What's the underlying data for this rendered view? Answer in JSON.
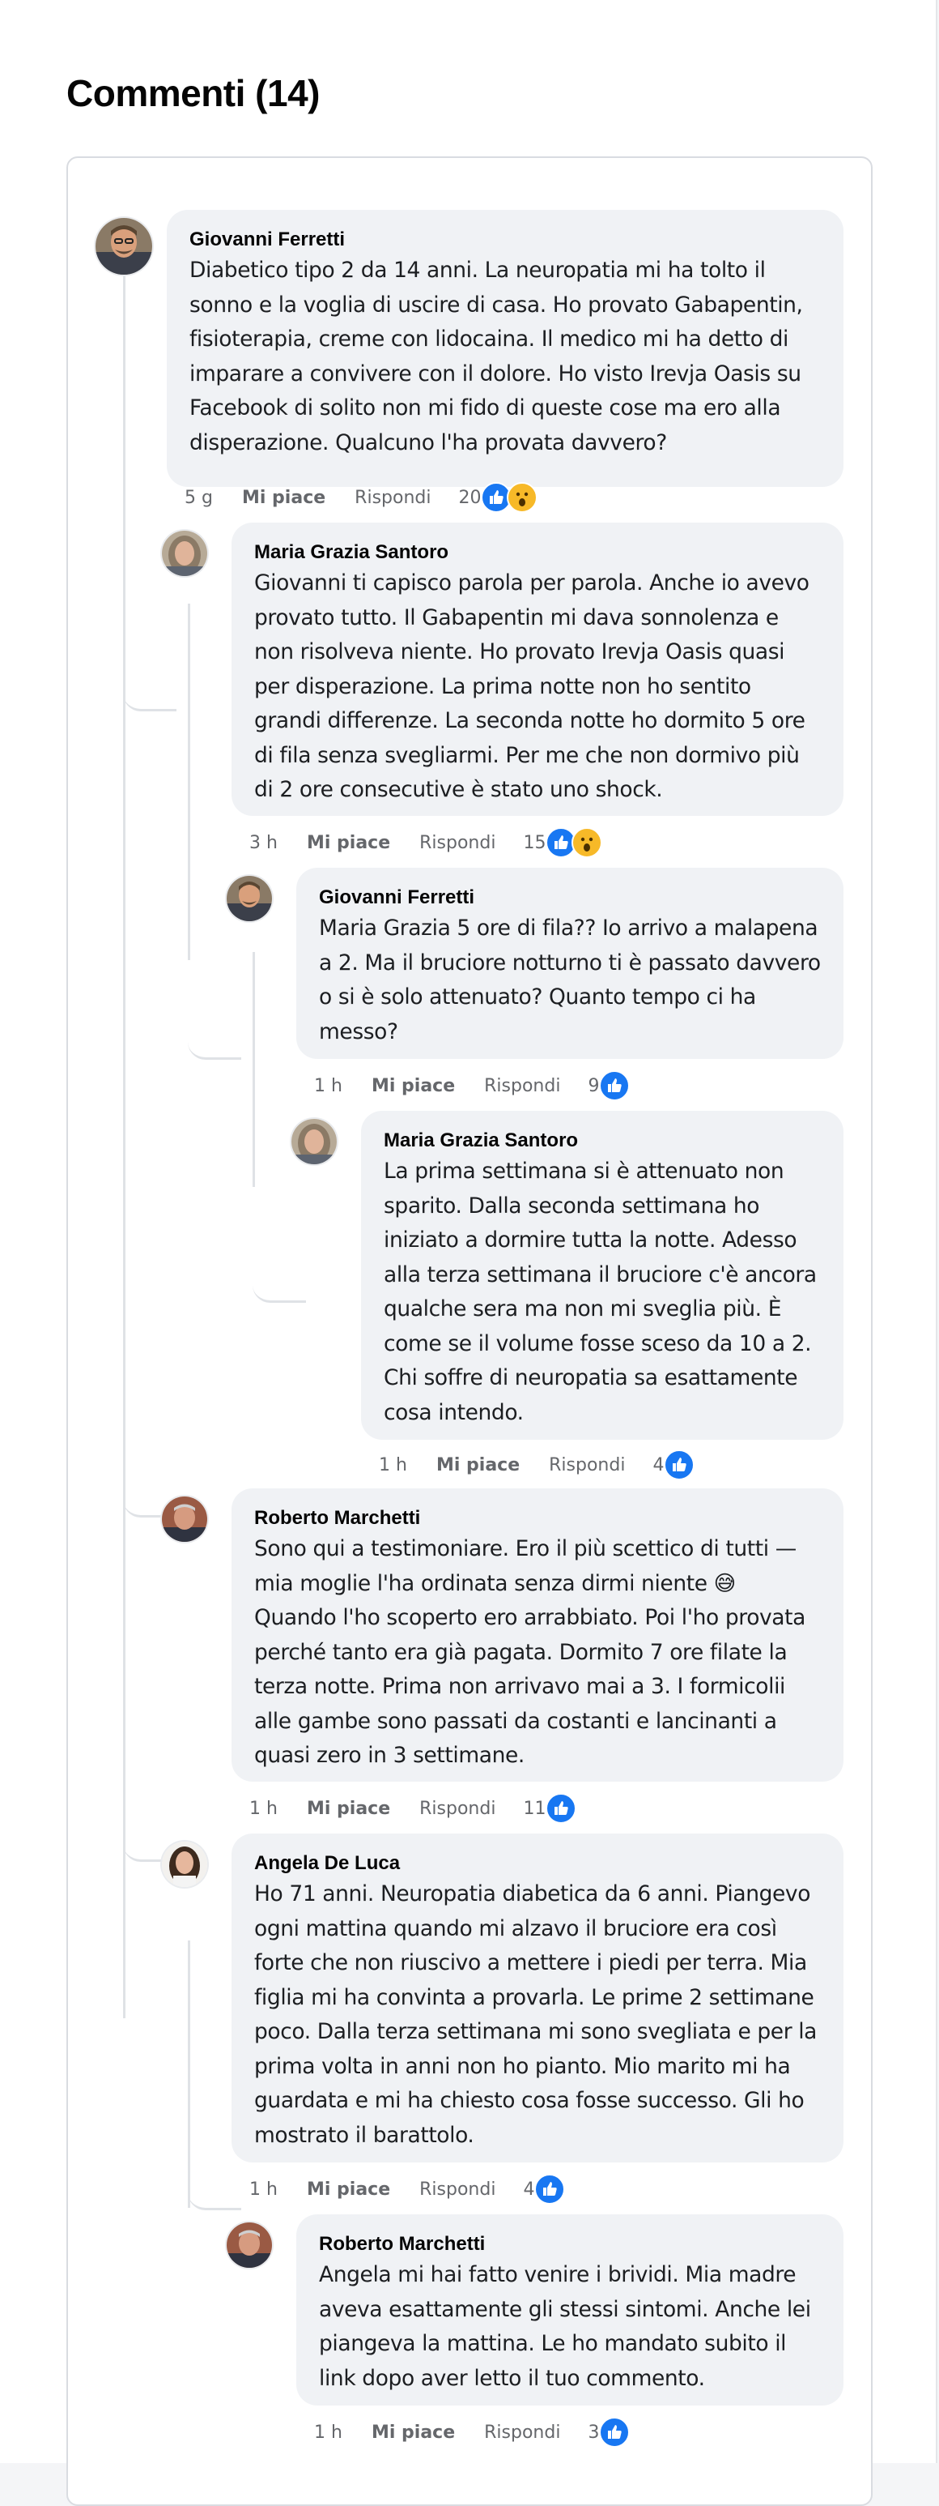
{
  "section": {
    "title": "Commenti (14)"
  },
  "colors": {
    "accent": "#1877f2",
    "bubble": "#f0f2f5",
    "meta": "#65676b",
    "wow": "#f7b928"
  },
  "actions": {
    "like": "Mi piace",
    "reply": "Rispondi"
  },
  "comments": [
    {
      "author": "Giovanni Ferretti",
      "text": "Diabetico tipo 2 da 14 anni. La neuropatia mi ha tolto il sonno e la voglia di uscire di casa. Ho provato Gabapentin, fisioterapia, creme con lidocaina. Il medico mi ha detto di imparare a convivere con il dolore. Ho visto Irevja Oasis su Facebook di solito non mi fido di queste cose ma ero alla disperazione. Qualcuno l'ha provata davvero?",
      "time": "5 g",
      "likes": "20",
      "reactions": [
        "thumbs-up-icon",
        "wow-icon"
      ]
    },
    {
      "author": "Maria Grazia Santoro",
      "text": "Giovanni ti capisco parola per parola. Anche io avevo provato tutto. Il Gabapentin mi dava sonnolenza e non risolveva niente. Ho provato Irevja Oasis quasi per disperazione. La prima notte non ho sentito grandi differenze. La seconda notte ho dormito 5 ore di fila senza svegliarmi. Per me che non dormivo più di 2 ore consecutive è stato uno shock.",
      "time": "3 h",
      "likes": "15",
      "reactions": [
        "thumbs-up-icon",
        "wow-icon"
      ]
    },
    {
      "author": "Giovanni Ferretti",
      "text": "Maria Grazia 5 ore di fila?? Io arrivo a malapena a 2. Ma il bruciore notturno ti è passato davvero o si è solo attenuato? Quanto tempo ci ha messo?",
      "time": "1 h",
      "likes": "9",
      "reactions": [
        "thumbs-up-icon"
      ]
    },
    {
      "author": "Maria Grazia Santoro",
      "text": "La prima settimana si è attenuato non sparito. Dalla seconda settimana ho iniziato a dormire tutta la notte. Adesso alla terza settimana il bruciore c'è ancora qualche sera ma non mi sveglia più. È come se il volume fosse sceso da 10 a 2. Chi soffre di neuropatia sa esattamente cosa intendo.",
      "time": "1 h",
      "likes": "4",
      "reactions": [
        "thumbs-up-icon"
      ]
    },
    {
      "author": "Roberto Marchetti",
      "text": "Sono qui a testimoniare. Ero il più scettico di tutti — mia moglie l'ha ordinata senza dirmi niente 😅 Quando l'ho scoperto ero arrabbiato. Poi l'ho provata perché tanto era già pagata. Dormito 7 ore filate la terza notte. Prima non arrivavo mai a 3. I formicolii alle gambe sono passati da costanti e lancinanti a quasi zero in 3 settimane.",
      "time": "1 h",
      "likes": "11",
      "reactions": [
        "thumbs-up-icon"
      ]
    },
    {
      "author": "Angela De Luca",
      "text": "Ho 71 anni. Neuropatia diabetica da 6 anni. Piangevo ogni mattina quando mi alzavo il bruciore era così forte che non riuscivo a mettere i piedi per terra. Mia figlia mi ha convinta a provarla. Le prime 2 settimane poco. Dalla terza settimana mi sono svegliata e per la prima volta in anni non ho pianto. Mio marito mi ha guardata e mi ha chiesto cosa fosse successo. Gli ho mostrato il barattolo.",
      "time": "1 h",
      "likes": "4",
      "reactions": [
        "thumbs-up-icon"
      ]
    },
    {
      "author": "Roberto Marchetti",
      "text": "Angela mi hai fatto venire i brividi. Mia madre aveva esattamente gli stessi sintomi. Anche lei piangeva la mattina. Le ho mandato subito il link dopo aver letto il tuo commento.",
      "time": "1 h",
      "likes": "3",
      "reactions": [
        "thumbs-up-icon"
      ]
    }
  ]
}
